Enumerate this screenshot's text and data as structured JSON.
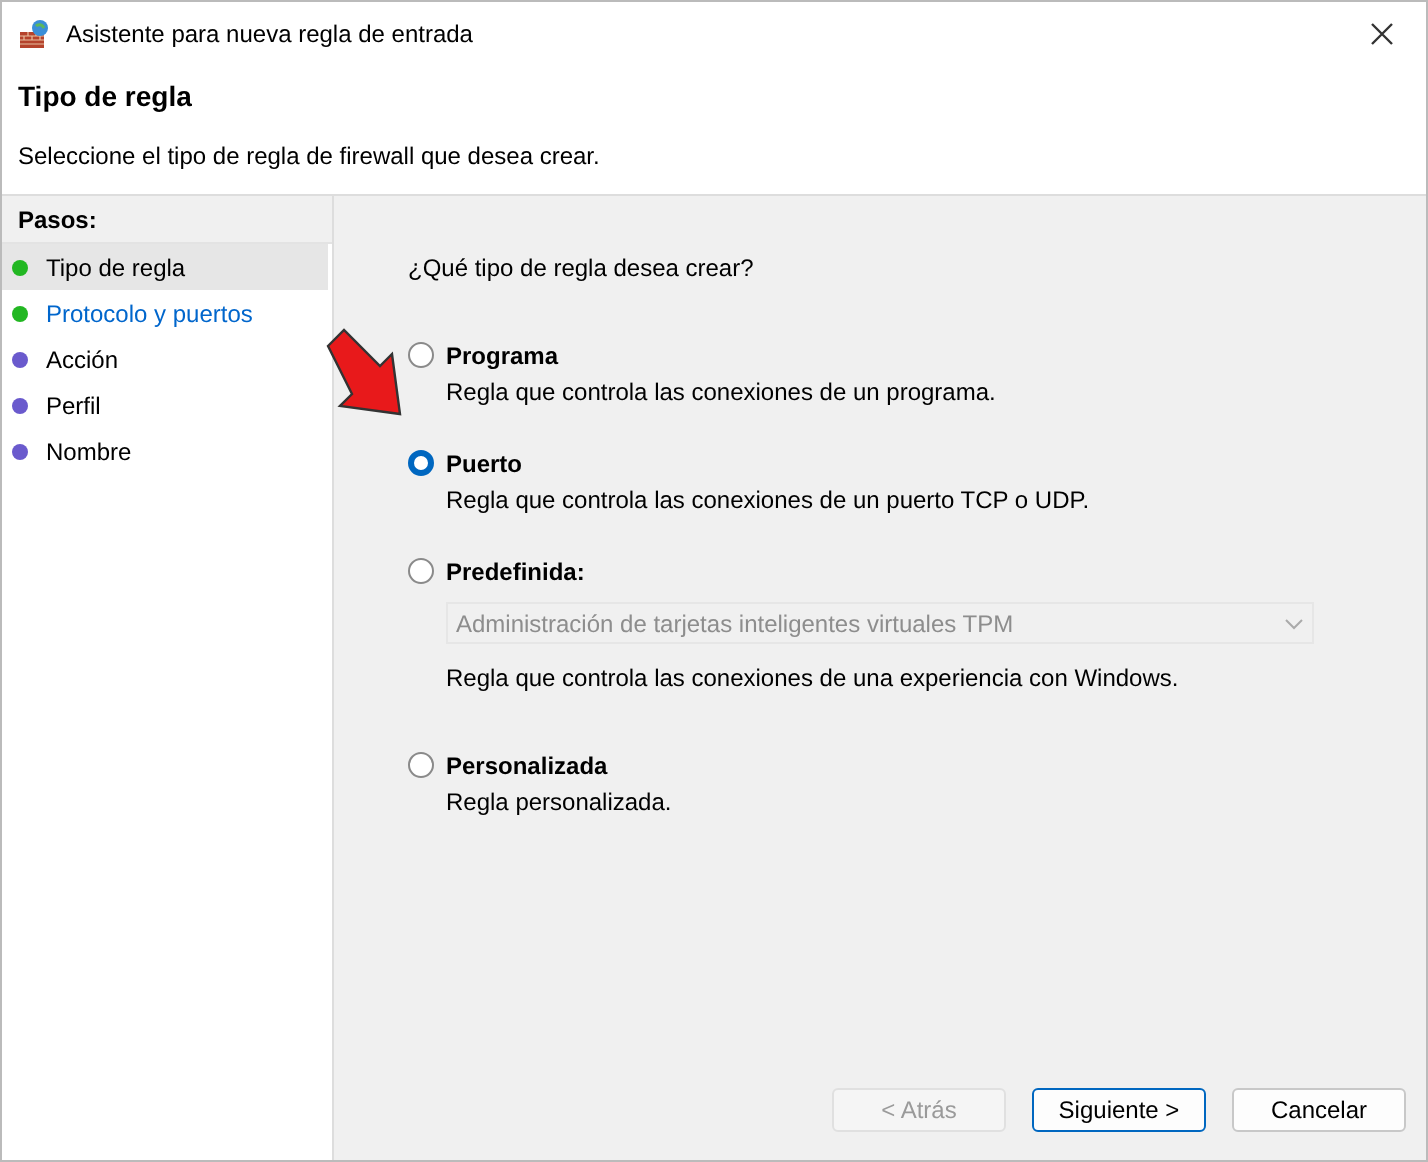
{
  "window": {
    "title": "Asistente para nueva regla de entrada"
  },
  "header": {
    "title": "Tipo de regla",
    "subtitle": "Seleccione el tipo de regla de firewall que desea crear."
  },
  "steps": {
    "title": "Pasos:",
    "items": [
      {
        "label": "Tipo de regla",
        "selected": true,
        "link": false,
        "color": "#22b722"
      },
      {
        "label": "Protocolo y puertos",
        "selected": false,
        "link": true,
        "color": "#22b722"
      },
      {
        "label": "Acción",
        "selected": false,
        "link": false,
        "color": "#6a5acd"
      },
      {
        "label": "Perfil",
        "selected": false,
        "link": false,
        "color": "#6a5acd"
      },
      {
        "label": "Nombre",
        "selected": false,
        "link": false,
        "color": "#6a5acd"
      }
    ]
  },
  "question": "¿Qué tipo de regla desea crear?",
  "options": [
    {
      "label": "Programa",
      "description": "Regla que controla las conexiones de un programa.",
      "selected": false
    },
    {
      "label": "Puerto",
      "description": "Regla que controla las conexiones de un puerto TCP o UDP.",
      "selected": true
    },
    {
      "label": "Predefinida:",
      "description": "Regla que controla las conexiones de una experiencia con Windows.",
      "selected": false,
      "dropdown": {
        "value": "Administración de tarjetas inteligentes virtuales TPM",
        "disabled": true
      }
    },
    {
      "label": "Personalizada",
      "description": "Regla personalizada.",
      "selected": false
    }
  ],
  "buttons": [
    {
      "label": "< Atrás",
      "disabled": true,
      "default": false
    },
    {
      "label": "Siguiente >",
      "disabled": false,
      "default": true
    },
    {
      "label": "Cancelar",
      "disabled": false,
      "default": false
    }
  ]
}
